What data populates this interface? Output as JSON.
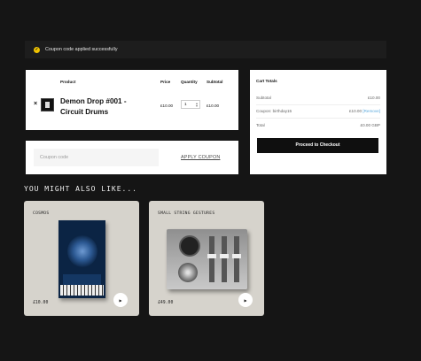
{
  "notice": {
    "message": "Coupon code applied successfully"
  },
  "cart": {
    "headers": {
      "product": "Product",
      "price": "Price",
      "quantity": "Quantity",
      "subtotal": "Subtotal"
    },
    "item": {
      "remove": "×",
      "name": "Demon Drop #001 - Circuit Drums",
      "price": "£10.00",
      "quantity": "1",
      "subtotal": "£10.00"
    }
  },
  "coupon": {
    "placeholder": "Coupon code",
    "apply_label": "APPLY COUPON"
  },
  "totals": {
    "title": "Cart Totals",
    "subtotal_label": "Subtotal",
    "subtotal_value": "£10.00",
    "coupon_label": "Coupon: birthday15",
    "coupon_value": "£10.00",
    "coupon_remove": "[Remove]",
    "total_label": "Total",
    "total_value": "£0.00 GBP",
    "checkout_label": "Proceed to Checkout"
  },
  "also": {
    "heading": "YOU MIGHT ALSO LIKE...",
    "products": [
      {
        "name": "COSMOS",
        "price": "£10.00"
      },
      {
        "name": "SMALL STRING GESTURES",
        "price": "£49.00"
      }
    ]
  }
}
